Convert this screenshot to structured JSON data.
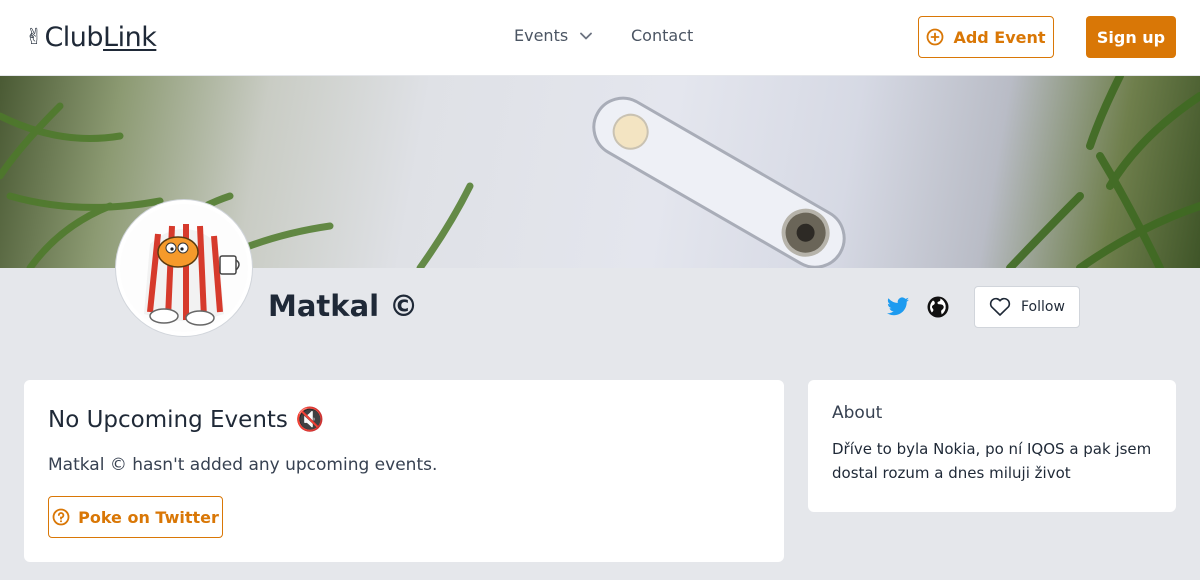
{
  "header": {
    "logo_prefix": "Club",
    "logo_suffix": "Link",
    "nav": {
      "events_label": "Events",
      "contact_label": "Contact"
    },
    "add_event_label": "Add Event",
    "sign_up_label": "Sign up"
  },
  "profile": {
    "name": "Matkal ©",
    "follow_label": "Follow",
    "social_icons": [
      "twitter-icon",
      "globe-icon"
    ]
  },
  "events_card": {
    "title": "No Upcoming Events",
    "title_icon": "🔇",
    "message": "Matkal © hasn't added any upcoming events.",
    "poke_label": "Poke on Twitter"
  },
  "about_card": {
    "title": "About",
    "text": "Dříve to byla Nokia, po ní IQOS a pak jsem dostal rozum a dnes miluji život"
  },
  "colors": {
    "accent": "#d97706",
    "background": "#e5e7eb",
    "twitter": "#1d9bf0"
  }
}
